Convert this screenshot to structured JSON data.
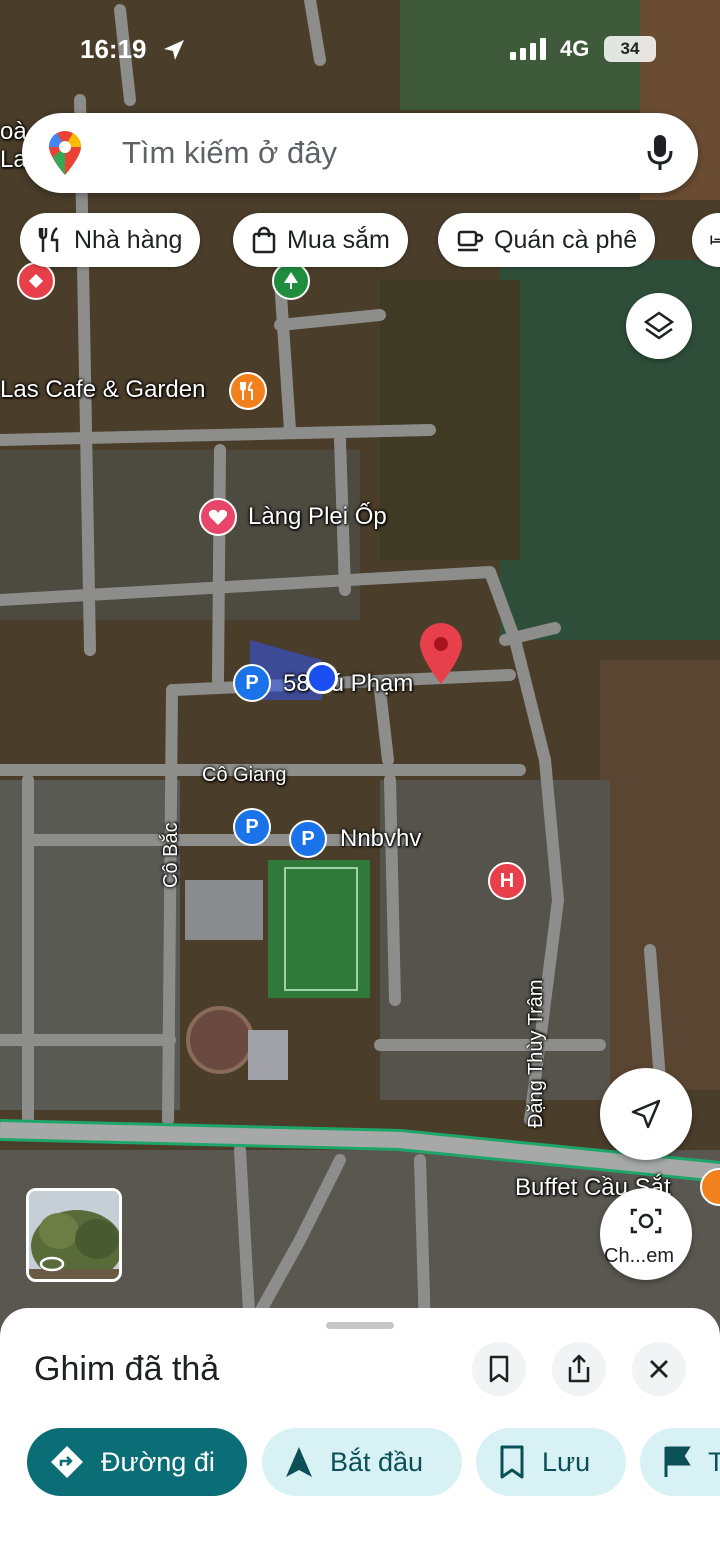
{
  "status_bar": {
    "time": "16:19",
    "network": "4G",
    "battery": "34"
  },
  "search": {
    "placeholder": "Tìm kiếm ở đây"
  },
  "chips": [
    {
      "label": "Nhà hàng",
      "icon": "fork-knife-icon"
    },
    {
      "label": "Mua sắm",
      "icon": "shopping-bag-icon"
    },
    {
      "label": "Quán cà phê",
      "icon": "coffee-cup-icon"
    }
  ],
  "map": {
    "labels": {
      "las_cafe": "Las Cafe & Garden",
      "lang_plei_op": "Làng Plei Ốp",
      "pham_street": "58 Tú Phạm",
      "co_giang": "Cô Giang",
      "co_bac": "Cô Bắc",
      "nnbvhv": "Nnbvhv",
      "dang_thuy_tram": "Đặng Thùy Trâm",
      "buffet": "Buffet Cầu Sắt",
      "top_left_fragment": "oà\nLa"
    },
    "poi_glyphs": {
      "parking": "P",
      "hospital": "H"
    },
    "colors": {
      "primary": "#0b6e76",
      "secondary_bg": "#d8f1f5",
      "pin_red": "#e8404a",
      "location_blue": "#1a4ef0"
    }
  },
  "controls": {
    "lens_label": "Ch...em"
  },
  "sheet": {
    "title": "Ghim đã thả",
    "actions": [
      {
        "label": "Đường đi",
        "icon": "directions-icon"
      },
      {
        "label": "Bắt đầu",
        "icon": "navigation-arrow-icon"
      },
      {
        "label": "Lưu",
        "icon": "bookmark-icon"
      },
      {
        "label": "T",
        "icon": "flag-icon"
      }
    ]
  }
}
